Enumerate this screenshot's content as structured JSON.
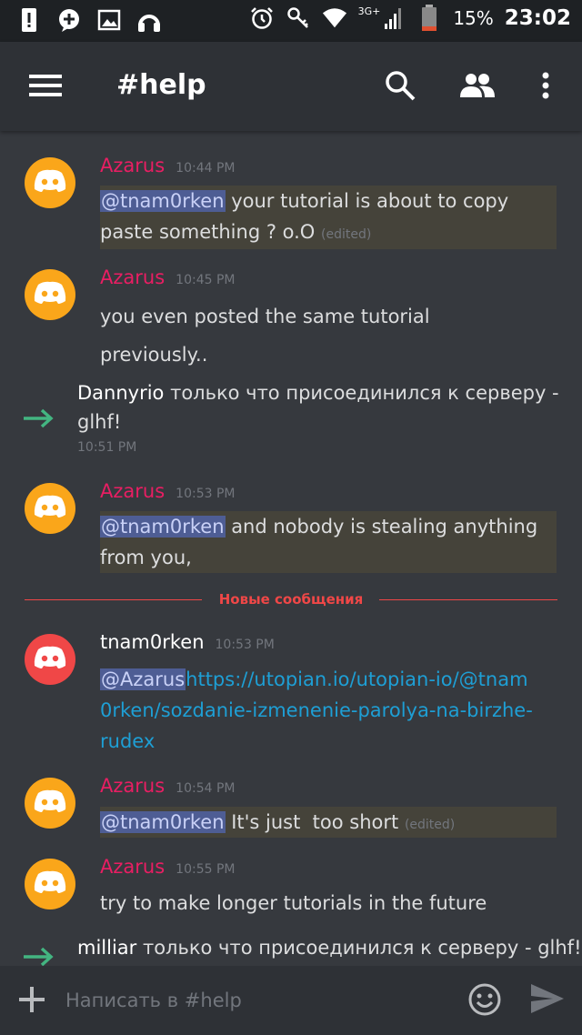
{
  "statusbar": {
    "network": "3G+",
    "battery": "15%",
    "time": "23:02",
    "icons": [
      "alert-icon",
      "messenger-icon",
      "gallery-icon",
      "headphones-icon",
      "alarm-icon",
      "key-icon",
      "wifi-icon",
      "signal-icon",
      "battery-icon"
    ]
  },
  "appbar": {
    "title": "#help",
    "icons": [
      "menu-icon",
      "search-icon",
      "members-icon",
      "more-icon"
    ]
  },
  "messages": [
    {
      "author": "Azarus",
      "time": "10:44 PM",
      "mention": "@tnam0rken",
      "text": " your tutorial is about to copy paste something ? o.O",
      "edited": "(edited)"
    },
    {
      "author": "Azarus",
      "time": "10:45 PM",
      "text": "you even posted the same tutorial previously.."
    },
    {
      "author": "Azarus",
      "time": "10:53 PM",
      "mention": "@tnam0rken",
      "text": " and nobody is stealing anything from you,"
    },
    {
      "author": "tnam0rken",
      "time": "10:53 PM",
      "mention": "@Azarus",
      "link": "https://utopian.io/utopian-io/@tnam0rken/sozdanie-izmenenie-parolya-na-birzhe-rudex"
    },
    {
      "author": "Azarus",
      "time": "10:54 PM",
      "mention": "@tnam0rken",
      "text": " It's just  too short ",
      "edited": "(edited)"
    },
    {
      "author": "Azarus",
      "time": "10:55 PM",
      "text": "try to make longer tutorials in the future"
    }
  ],
  "joins": [
    {
      "name": "Dannyrio",
      "text": " только что присоединился к серверу - glhf!",
      "time": "10:51 PM"
    },
    {
      "name": "milliar",
      "text": " только что присоединился к серверу - glhf!"
    }
  ],
  "divider": {
    "label": "Новые сообщения"
  },
  "input": {
    "placeholder": "Написать в #help"
  },
  "colors": {
    "accent_pink": "#e91e63",
    "mention_bg": "#4e5d94",
    "link": "#1e9fd5",
    "new_messages": "#f04747",
    "avatar_orange": "#faa61a",
    "avatar_red": "#f04747",
    "join_arrow": "#43b581"
  }
}
